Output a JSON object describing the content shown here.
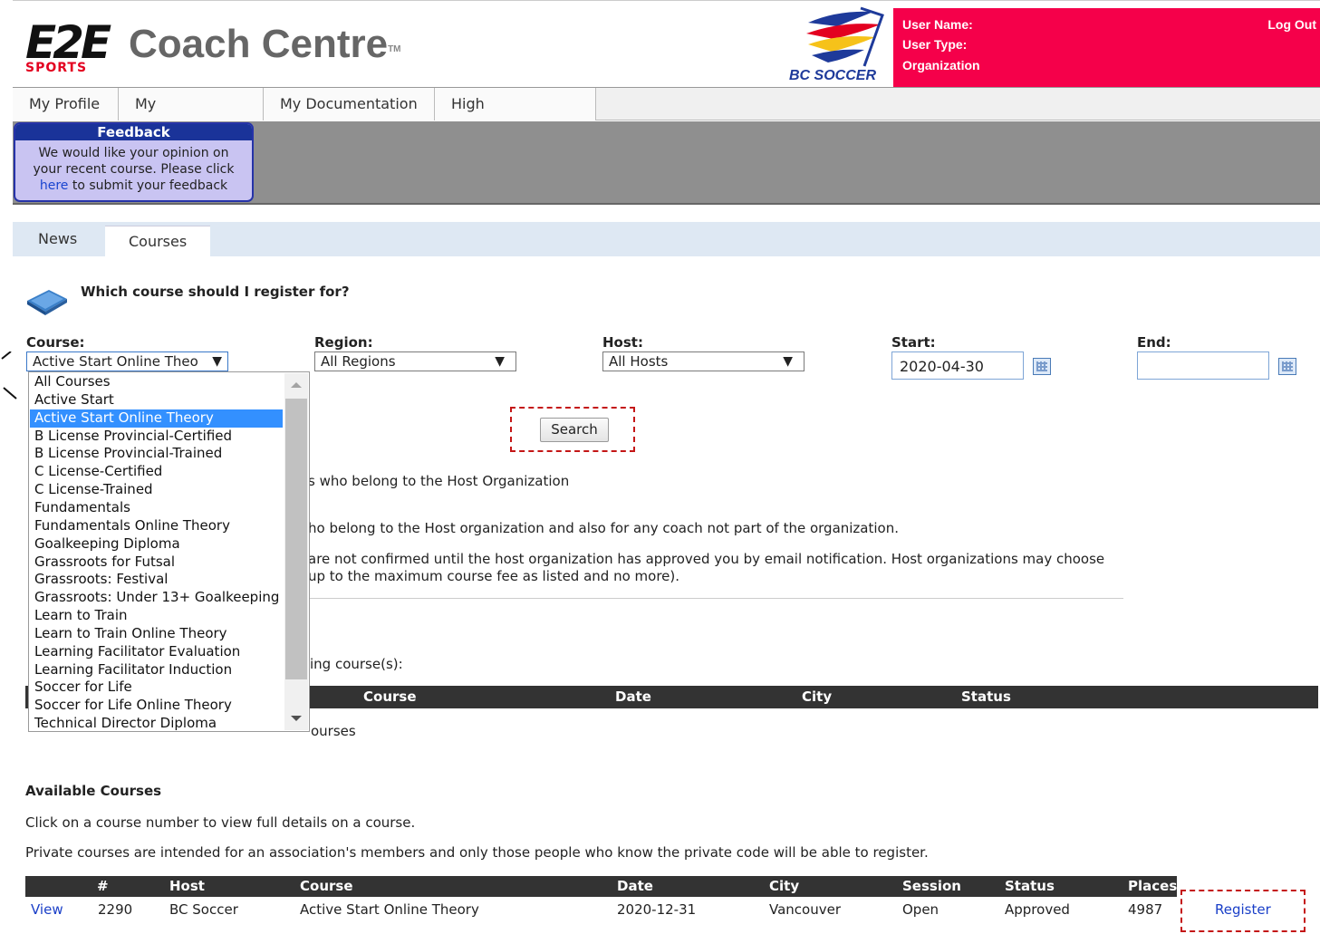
{
  "header": {
    "logo_text": "E2E",
    "logo_sub": "SPORTS",
    "app_title": "Coach Centre",
    "trademark": "TM",
    "partner_logo": "BC SOCCER",
    "user_name_label": "User Name:",
    "user_type_label": "User Type:",
    "organization_label": "Organization",
    "logout": "Log Out",
    "colors": {
      "userbox": "#f5004a",
      "title": "#666666"
    }
  },
  "nav": {
    "items": [
      {
        "label": "My Profile"
      },
      {
        "label": "My Certification"
      },
      {
        "label": "My Documentation"
      },
      {
        "label": "High Performance"
      }
    ]
  },
  "feedback": {
    "title": "Feedback",
    "line1": "We would like your opinion on",
    "line2": "your recent course. Please click",
    "link": "here",
    "line3_rest": " to submit your feedback"
  },
  "tabs": [
    {
      "label": "News",
      "active": false
    },
    {
      "label": "Courses",
      "active": true
    }
  ],
  "question": "Which course should I register for?",
  "filters": {
    "course": {
      "label": "Course:",
      "value": "Active Start Online Theo"
    },
    "region": {
      "label": "Region:",
      "value": "All Regions"
    },
    "host": {
      "label": "Host:",
      "value": "All Hosts"
    },
    "start": {
      "label": "Start:",
      "value": "2020-04-30"
    },
    "end": {
      "label": "End:",
      "value": ""
    },
    "arrow": "▼"
  },
  "course_options": [
    "All Courses",
    "Active Start",
    "Active Start Online Theory",
    "B License Provincial-Certified",
    "B License Provincial-Trained",
    "C License-Certified",
    "C License-Trained",
    "Fundamentals",
    "Fundamentals Online Theory",
    "Goalkeeping Diploma",
    "Grassroots for Futsal",
    "Grassroots: Festival",
    "Grassroots: Under 13+ Goalkeeping",
    "Learn to Train",
    "Learn to Train Online Theory",
    "Learning Facilitator Evaluation",
    "Learning Facilitator Induction",
    "Soccer for Life",
    "Soccer for Life Online Theory",
    "Technical Director Diploma"
  ],
  "selected_option_index": 2,
  "search_label": "Search",
  "info": {
    "line1": "s who belong to the Host Organization",
    "line2": "ho belong to the Host organization and also for any coach not part of the organization.",
    "line3": "are not confirmed until the host organization has approved you by email notification. Host organizations may choose",
    "line4": "up to the maximum course fee as listed and no more).",
    "line5": "ing course(s):",
    "not_registered_tail": "ourses"
  },
  "registered_table": {
    "headers": [
      "Course",
      "Date",
      "City",
      "Status"
    ]
  },
  "available": {
    "title": "Available Courses",
    "note1": "Click on a course number to view full details on a course.",
    "note2": "Private courses are intended for an association's members and only those people who know the private code will be able to register.",
    "headers": [
      "#",
      "Host",
      "Course",
      "Date",
      "City",
      "Session",
      "Status",
      "Places"
    ],
    "rows": [
      {
        "view": "View",
        "number": "2290",
        "host": "BC Soccer",
        "course": "Active Start Online Theory",
        "date": "2020-12-31",
        "city": "Vancouver",
        "session": "Open",
        "status": "Approved",
        "places": "4987",
        "register": "Register"
      }
    ]
  }
}
